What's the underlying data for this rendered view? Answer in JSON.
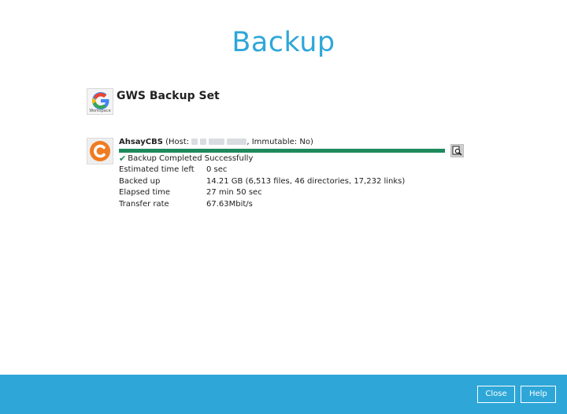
{
  "page": {
    "title": "Backup"
  },
  "backup_set": {
    "name": "GWS Backup Set",
    "logo_icon": "google-workspace-icon",
    "logo_caption": "Workspace"
  },
  "destination": {
    "logo_icon": "ahsay-logo-icon",
    "name": "AhsayCBS",
    "host_prefix": " (Host: ",
    "immutable_text": ", Immutable: No)",
    "progress_fraction": 1.0,
    "status_icon": "check-icon",
    "status_text": "Backup Completed Successfully",
    "detail_icon": "magnifier-report-icon"
  },
  "stats": [
    {
      "label": "Estimated time left",
      "value": "0 sec"
    },
    {
      "label": "Backed up",
      "value": "14.21 GB (6,513 files, 46 directories, 17,232 links)"
    },
    {
      "label": "Elapsed time",
      "value": "27 min 50 sec"
    },
    {
      "label": "Transfer rate",
      "value": "67.63Mbit/s"
    }
  ],
  "footer": {
    "close_label": "Close",
    "help_label": "Help"
  },
  "colors": {
    "accent": "#2ea7d8",
    "progress": "#1e8a5c",
    "ahsay_orange": "#f07c22"
  }
}
